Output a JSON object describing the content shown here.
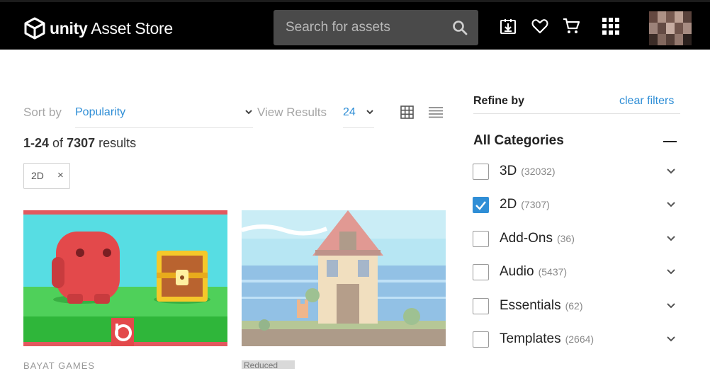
{
  "header": {
    "logo_unity": "unity",
    "logo_store": "Asset Store",
    "search_placeholder": "Search for assets"
  },
  "toolbar": {
    "sort_label": "Sort by",
    "sort_value": "Popularity",
    "view_label": "View Results",
    "view_value": "24"
  },
  "results": {
    "range": "1-24",
    "of": "of",
    "total": "7307",
    "suffix": "results"
  },
  "chip": {
    "label": "2D",
    "remove": "×"
  },
  "cards": [
    {
      "vendor": "BAYAT GAMES"
    },
    {
      "tag": "Reduced"
    }
  ],
  "refine": {
    "title": "Refine by",
    "clear": "clear filters",
    "categories_title": "All Categories",
    "categories": [
      {
        "name": "3D",
        "count": "(32032)",
        "checked": false
      },
      {
        "name": "2D",
        "count": "(7307)",
        "checked": true
      },
      {
        "name": "Add-Ons",
        "count": "(36)",
        "checked": false
      },
      {
        "name": "Audio",
        "count": "(5437)",
        "checked": false
      },
      {
        "name": "Essentials",
        "count": "(62)",
        "checked": false
      },
      {
        "name": "Templates",
        "count": "(2664)",
        "checked": false
      }
    ]
  },
  "colors": {
    "accent": "#2f8ed6",
    "header_bg": "#000000",
    "search_bg": "#4a4a4a"
  },
  "icons": [
    "unity-logo-icon",
    "search-icon",
    "downloads-icon",
    "heart-icon",
    "cart-icon",
    "apps-grid-icon",
    "grid-view-icon",
    "list-view-icon",
    "chevron-down-icon",
    "minus-icon",
    "check-icon"
  ]
}
